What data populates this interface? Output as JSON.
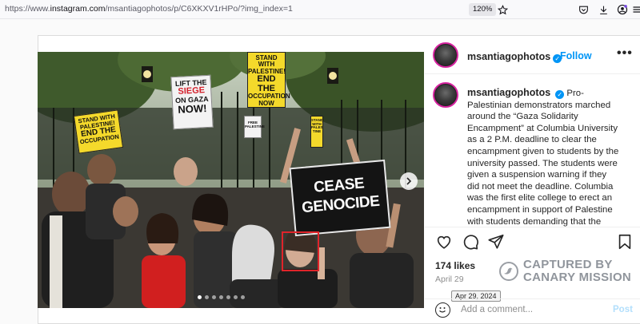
{
  "browser": {
    "url_prefix": "https://www.",
    "url_domain": "instagram.com",
    "url_path": "/msantiagophotos/p/C6XKXV1rHPo/?img_index=1",
    "zoom": "120%",
    "icons": [
      "star-icon",
      "pocket-icon",
      "download-icon",
      "account-icon",
      "menu-icon"
    ]
  },
  "post": {
    "username": "msantiagophotos",
    "follow_label": "Follow",
    "more_label": "•••",
    "caption": "Pro-Palestinian demonstrators marched around the “Gaza Solidarity Encampment” at Columbia University as a 2 P.M. deadline to clear the encampment given to students by the university passed. The students were given a suspension warning if they did not meet the deadline. Columbia was the first elite college to erect an encampment in support of Palestine with students demanding that the",
    "likes": "174 likes",
    "date": "April 29",
    "tooltip": "Apr 29, 2024",
    "comment_placeholder": "Add a comment...",
    "post_label": "Post"
  },
  "photo_signs": {
    "cease": [
      "CEASE",
      "GENOCIDE"
    ],
    "siege": [
      "LIFT THE",
      "SIEGE",
      "ON GAZA",
      "NOW!"
    ],
    "yellow_left": [
      "STAND WITH",
      "PALESTINE!",
      "END THE",
      "OCCUPATION"
    ],
    "yellow_top": [
      "STAND WITH",
      "PALESTINE!",
      "END THE",
      "OCCUPATION",
      "NOW"
    ],
    "small_right": [
      "STAND",
      "WITH",
      "PALES",
      "TINE"
    ],
    "small_left": [
      "FREE",
      "PALESTINE"
    ]
  },
  "watermark": {
    "line1": "CAPTURED BY",
    "line2": "CANARY MISSION"
  },
  "colors": {
    "accent_blue": "#0095f6",
    "highlight_red": "#e0242a",
    "sign_yellow": "#f4d92b"
  }
}
